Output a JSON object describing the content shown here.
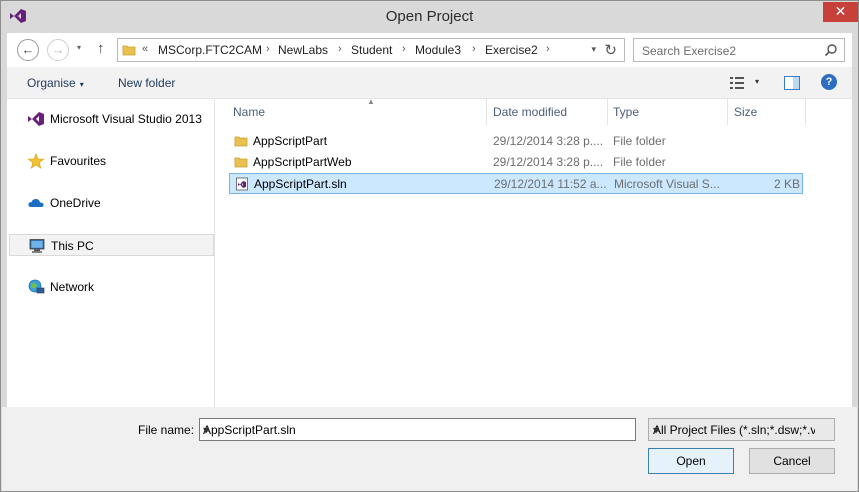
{
  "window": {
    "title": "Open Project",
    "close_label": "✕"
  },
  "nav": {
    "back_icon": "←",
    "forward_icon": "→",
    "recent_icon": "▾",
    "up_icon": "↑"
  },
  "address": {
    "overflow": "«",
    "crumbs": [
      "MSCorp.FTC2CAM",
      "NewLabs",
      "Student",
      "Module3",
      "Exercise2"
    ],
    "separator": "›",
    "dropdown": "▾",
    "refresh": "↻"
  },
  "search": {
    "placeholder": "Search Exercise2"
  },
  "commands": {
    "organise": "Organise",
    "organise_dd": "▾",
    "new_folder": "New folder",
    "view_dd": "▾",
    "help": "?"
  },
  "navpane": {
    "items": [
      {
        "label": "Microsoft Visual Studio 2013",
        "icon": "visual-studio-icon"
      },
      {
        "label": "Favourites",
        "icon": "star-icon"
      },
      {
        "label": "OneDrive",
        "icon": "cloud-icon"
      },
      {
        "label": "This PC",
        "icon": "computer-icon"
      },
      {
        "label": "Network",
        "icon": "network-icon"
      }
    ]
  },
  "filelist": {
    "columns": {
      "name": "Name",
      "date": "Date modified",
      "type": "Type",
      "size": "Size",
      "sort_arrow": "▲"
    },
    "rows": [
      {
        "name": "AppScriptPart",
        "date": "29/12/2014 3:28 p....",
        "type": "File folder",
        "size": "",
        "icon": "folder-icon"
      },
      {
        "name": "AppScriptPartWeb",
        "date": "29/12/2014 3:28 p....",
        "type": "File folder",
        "size": "",
        "icon": "folder-icon"
      },
      {
        "name": "AppScriptPart.sln",
        "date": "29/12/2014 11:52 a...",
        "type": "Microsoft Visual S...",
        "size": "2 KB",
        "icon": "solution-file-icon"
      }
    ]
  },
  "bottom": {
    "file_name_label": "File name:",
    "file_name_value": "AppScriptPart.sln",
    "dropdown": "▾",
    "filter_value": "All Project Files (*.sln;*.dsw;*.vc",
    "open_label": "Open",
    "cancel_label": "Cancel"
  },
  "colors": {
    "accent": "#68217a",
    "selection": "#cce8ff",
    "close": "#c7403a"
  }
}
